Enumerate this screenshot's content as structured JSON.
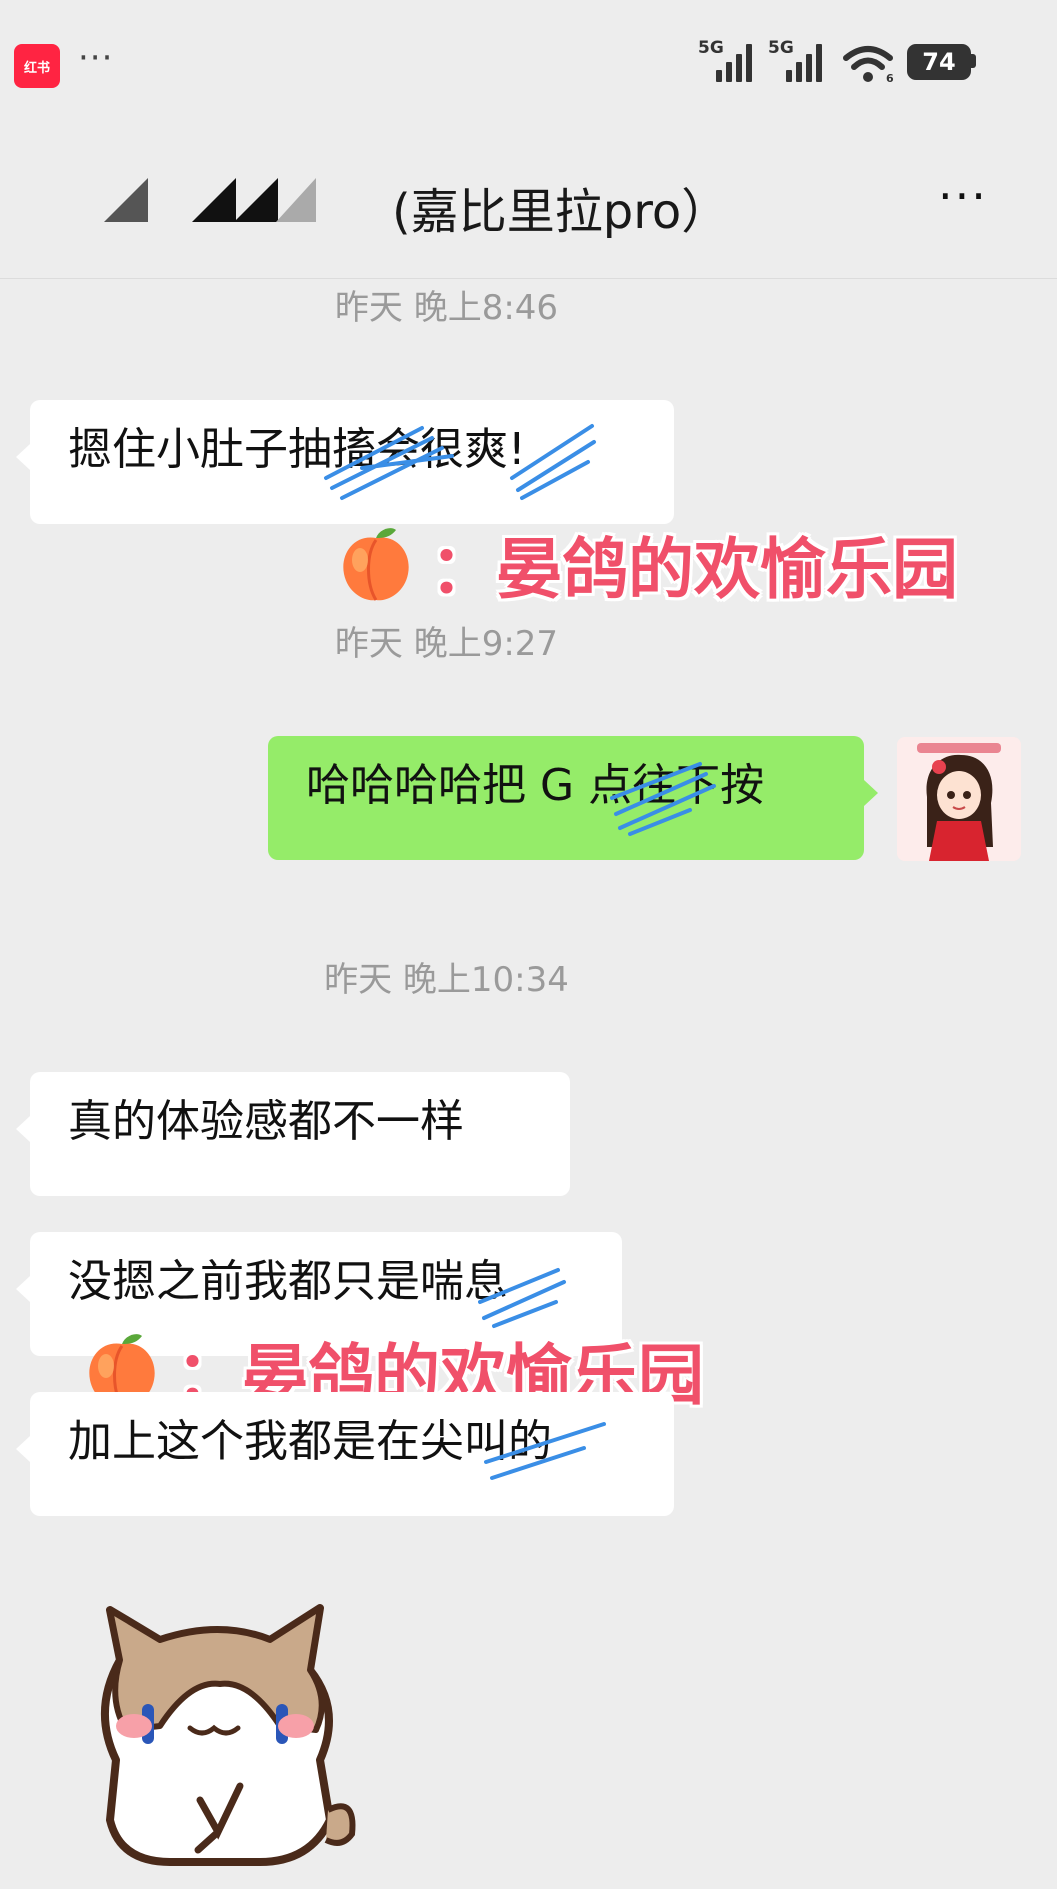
{
  "status_bar": {
    "app_badge": "红书",
    "more": "···",
    "signal1": "5G",
    "signal2": "5G",
    "battery": "74"
  },
  "header": {
    "title": "(嘉比里拉pro）",
    "more": "···"
  },
  "messages": [
    {
      "kind": "timestamp",
      "text": "昨天 晚上8:46"
    },
    {
      "kind": "incoming",
      "text": "摁住小肚子抽搐会很爽!"
    },
    {
      "kind": "timestamp",
      "text": "昨天 晚上9:27"
    },
    {
      "kind": "outgoing",
      "text": "哈哈哈哈把 G 点往下按"
    },
    {
      "kind": "timestamp",
      "text": "昨天 晚上10:34"
    },
    {
      "kind": "incoming",
      "text": "真的体验感都不一样"
    },
    {
      "kind": "incoming",
      "text": "没摁之前我都只是喘息"
    },
    {
      "kind": "incoming",
      "text": "加上这个我都是在尖叫的"
    }
  ],
  "watermark": {
    "text": "：晏鸽的欢愉乐园",
    "color": "#f0506a"
  },
  "colors": {
    "background": "#ededed",
    "outgoing_bubble": "#95ec69",
    "incoming_bubble": "#ffffff",
    "scribble": "#3a8ee6"
  },
  "icons": {
    "avatar": "cartoon-girl-avatar",
    "sticker": "cat-sticker",
    "peach": "peach-emoji"
  }
}
